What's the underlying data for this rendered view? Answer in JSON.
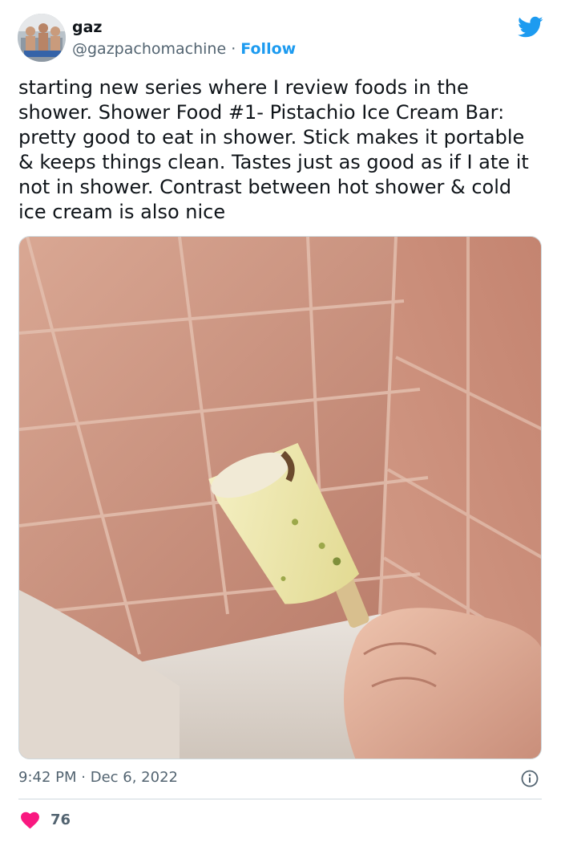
{
  "author": {
    "display_name": "gaz",
    "handle": "@gazpachomachine",
    "separator": "·",
    "follow_label": "Follow"
  },
  "tweet": {
    "text": "starting new series where I review foods in the shower. Shower Food #1- Pistachio Ice Cream Bar: pretty good to eat in shower. Stick makes it portable & keeps things clean. Tastes just as good as if I ate it not in shower. Contrast between hot shower & cold ice cream is also nice",
    "time": "9:42 PM",
    "date": "Dec 6, 2022",
    "likes": "76"
  },
  "icons": {
    "brand": "twitter-bird-icon",
    "info": "info-icon",
    "like": "heart-icon"
  },
  "colors": {
    "accent": "#1d9bf0",
    "like": "#f91880",
    "secondary_text": "#536471",
    "border": "#cfd9de"
  }
}
